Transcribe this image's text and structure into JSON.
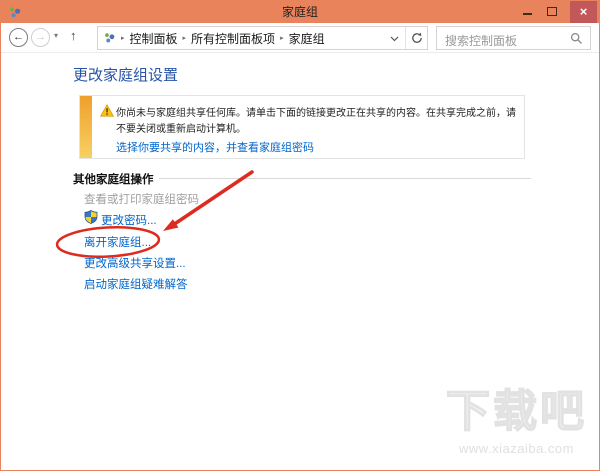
{
  "window": {
    "title": "家庭组"
  },
  "icons": {
    "close": "×",
    "back": "←",
    "forward": "→",
    "up": "↑",
    "dropdown_caret": "▾",
    "breadcrumb_separator": "▸"
  },
  "toolbar": {
    "breadcrumb": [
      "控制面板",
      "所有控制面板项",
      "家庭组"
    ],
    "search_placeholder": "搜索控制面板"
  },
  "main": {
    "heading": "更改家庭组设置",
    "warning": {
      "line1": "你尚未与家庭组共享任何库。请单击下面的链接更改正在共享的内容。在共享完成之前，请",
      "line2": "不要关闭或重新启动计算机。",
      "link": "选择你要共享的内容，并查看家庭组密码"
    },
    "section_header": "其他家庭组操作",
    "links": [
      {
        "label": "查看或打印家庭组密码",
        "state": "disabled"
      },
      {
        "label": "更改密码...",
        "state": "enabled",
        "uac_shield": true
      },
      {
        "label": "离开家庭组...",
        "state": "enabled"
      },
      {
        "label": "更改高级共享设置...",
        "state": "enabled"
      },
      {
        "label": "启动家庭组疑难解答",
        "state": "enabled"
      }
    ]
  },
  "annotation": {
    "highlighted_link": "离开家庭组...",
    "color": "#dd2b1f"
  },
  "watermark": {
    "title": "下载吧",
    "url": "www.xiazaiba.com"
  },
  "colors": {
    "titlebar": "#e8835c",
    "close_button": "#c2585a",
    "heading_blue": "#2853a6",
    "link_blue": "#0066cc",
    "disabled_gray": "#a0a0a0",
    "warning_bar_top": "#efa02c",
    "warning_bar_bottom": "#f7d163",
    "annotation_red": "#dd2b1f",
    "watermark_gray": "#e2e2e2"
  }
}
